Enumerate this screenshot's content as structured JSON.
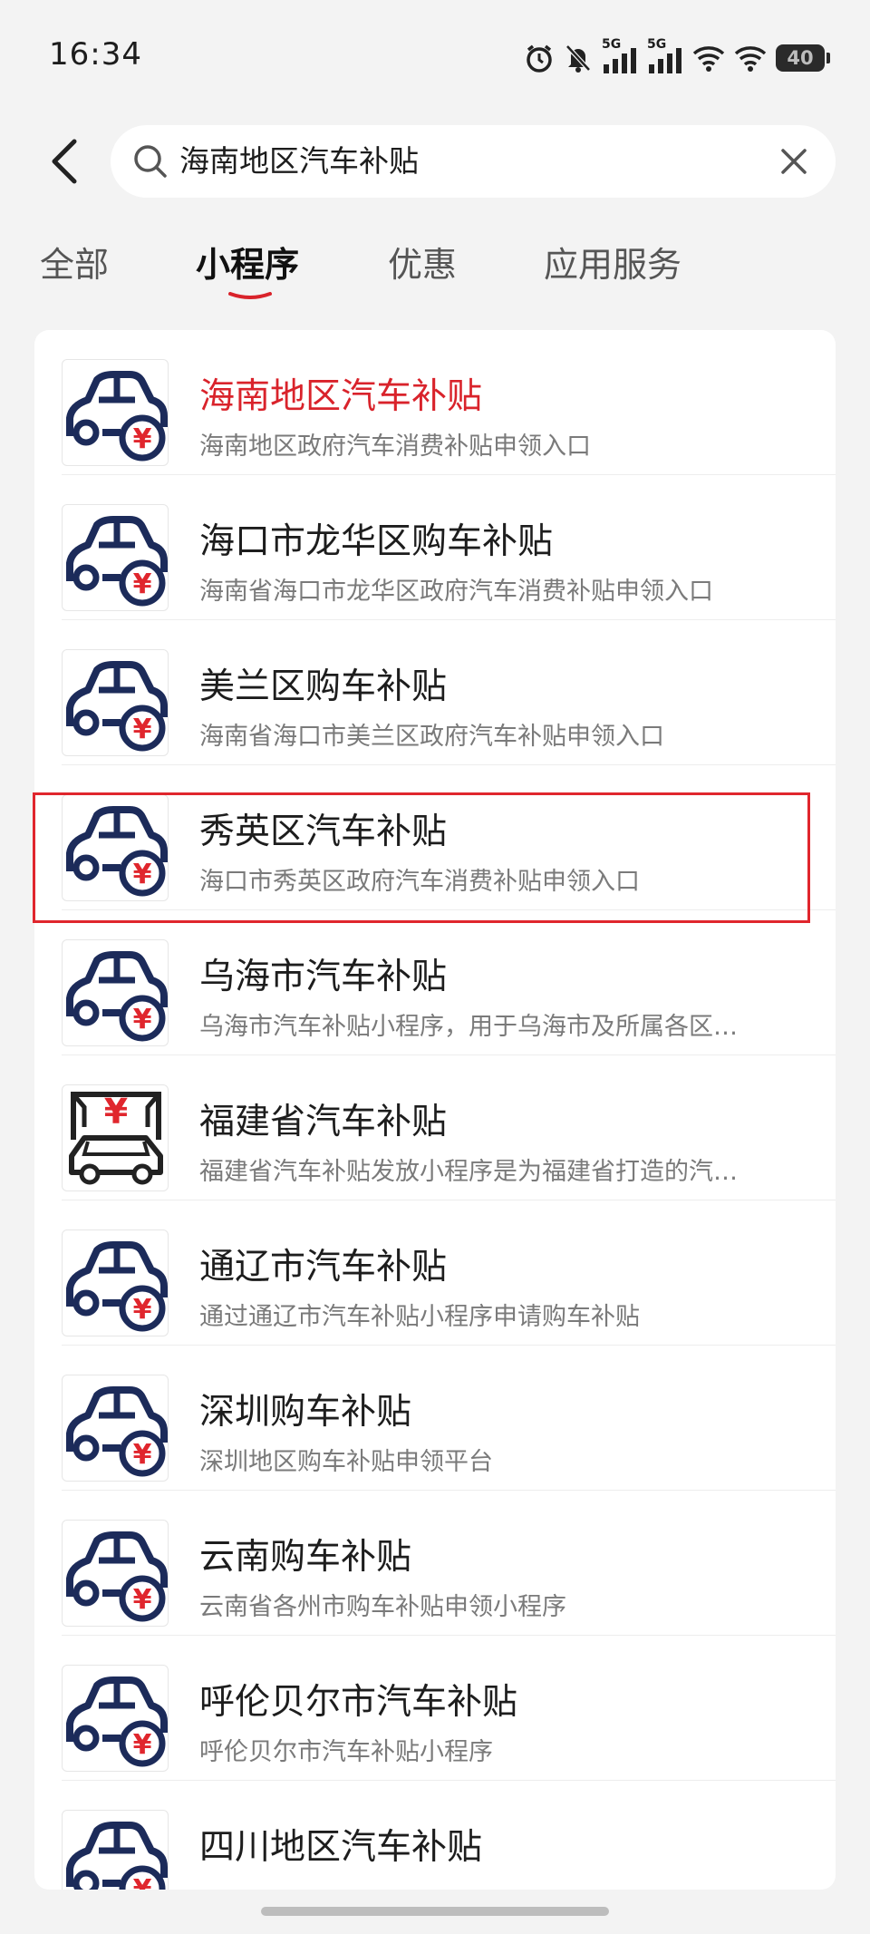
{
  "status_bar": {
    "time": "16:34",
    "network_1": "5G",
    "network_2": "5G",
    "battery": "40"
  },
  "search": {
    "query": "海南地区汽车补贴"
  },
  "tabs": [
    {
      "label": "全部",
      "active": false
    },
    {
      "label": "小程序",
      "active": true
    },
    {
      "label": "优惠",
      "active": false
    },
    {
      "label": "应用服务",
      "active": false
    }
  ],
  "colors": {
    "accent": "#d9232b",
    "icon_navy": "#1c2b5a",
    "icon_red": "#e0262d"
  },
  "results": [
    {
      "title": "海南地区汽车补贴",
      "desc": "海南地区政府汽车消费补贴申领入口",
      "icon": "car-yuan-icon",
      "highlight_title": true
    },
    {
      "title": "海口市龙华区购车补贴",
      "desc": "海南省海口市龙华区政府汽车消费补贴申领入口",
      "icon": "car-yuan-icon"
    },
    {
      "title": "美兰区购车补贴",
      "desc": "海南省海口市美兰区政府汽车补贴申领入口",
      "icon": "car-yuan-icon"
    },
    {
      "title": "秀英区汽车补贴",
      "desc": "海口市秀英区政府汽车消费补贴申领入口",
      "icon": "car-yuan-icon",
      "boxed": true
    },
    {
      "title": "乌海市汽车补贴",
      "desc": "乌海市汽车补贴小程序，用于乌海市及所属各区…",
      "icon": "car-yuan-icon"
    },
    {
      "title": "福建省汽车补贴",
      "desc": "福建省汽车补贴发放小程序是为福建省打造的汽…",
      "icon": "car-gate-yuan-icon"
    },
    {
      "title": "通辽市汽车补贴",
      "desc": "通过通辽市汽车补贴小程序申请购车补贴",
      "icon": "car-yuan-icon"
    },
    {
      "title": "深圳购车补贴",
      "desc": "深圳地区购车补贴申领平台",
      "icon": "car-yuan-icon"
    },
    {
      "title": "云南购车补贴",
      "desc": "云南省各州市购车补贴申领小程序",
      "icon": "car-yuan-icon"
    },
    {
      "title": "呼伦贝尔市汽车补贴",
      "desc": "呼伦贝尔市汽车补贴小程序",
      "icon": "car-yuan-icon"
    },
    {
      "title": "四川地区汽车补贴",
      "desc": "",
      "icon": "car-yuan-icon"
    }
  ]
}
